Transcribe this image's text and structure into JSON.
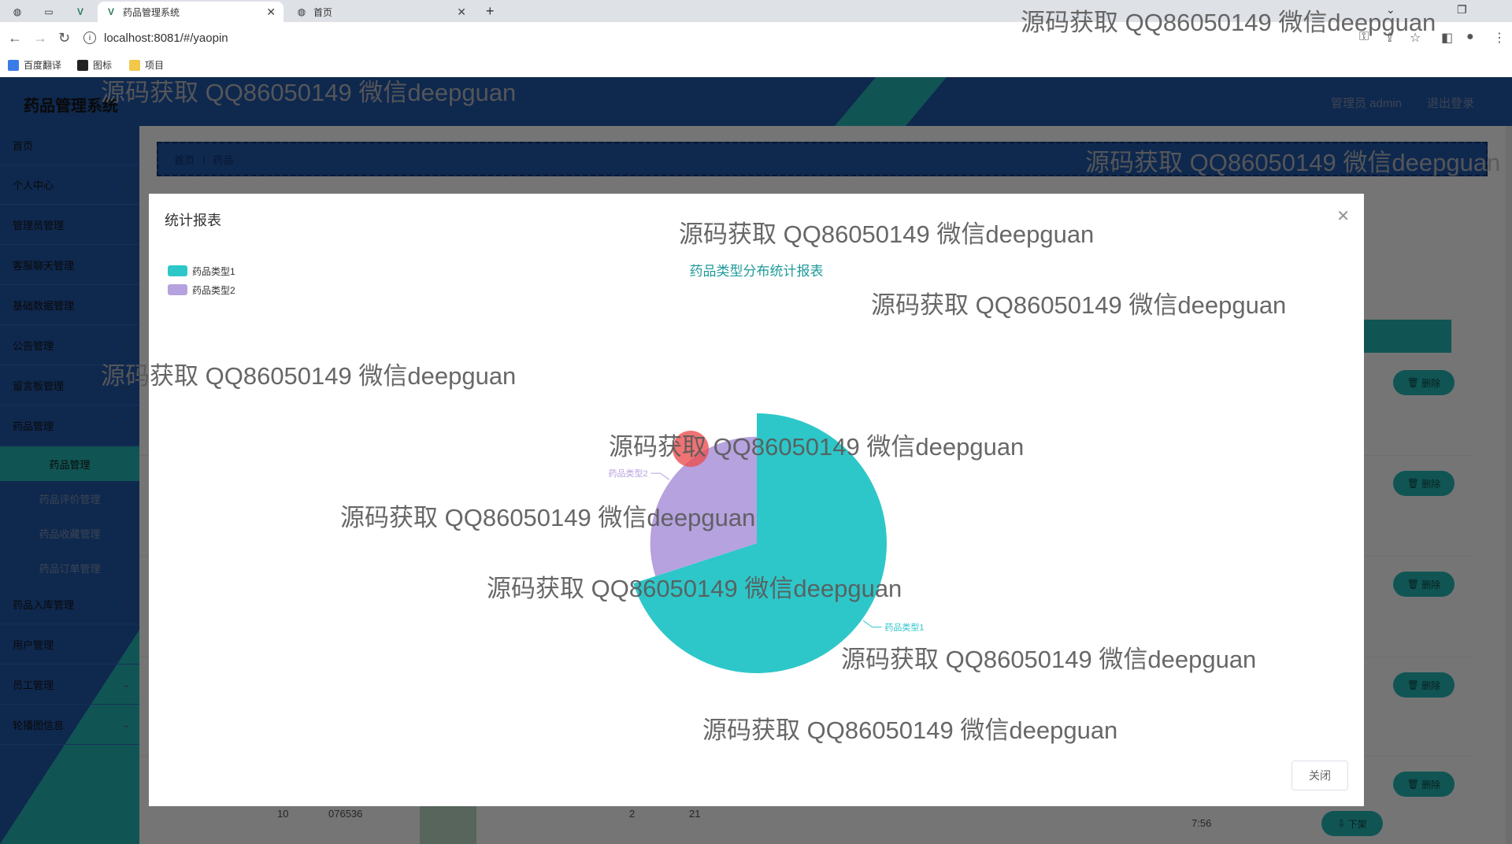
{
  "browser": {
    "tabs": [
      {
        "title": "药品管理系统",
        "active": true
      },
      {
        "title": "首页",
        "active": false
      }
    ],
    "url": "localhost:8081/#/yaopin",
    "bookmarks": [
      "百度翻译",
      "图标",
      "项目"
    ]
  },
  "header": {
    "title": "药品管理系统",
    "user": "管理员 admin",
    "logout": "退出登录"
  },
  "sidebar": {
    "items": [
      {
        "label": "首页",
        "chevron": false
      },
      {
        "label": "个人中心",
        "chevron": true
      },
      {
        "label": "管理员管理",
        "chevron": true
      },
      {
        "label": "客服聊天管理",
        "chevron": true
      },
      {
        "label": "基础数据管理",
        "chevron": true
      },
      {
        "label": "公告管理",
        "chevron": true
      },
      {
        "label": "留言板管理",
        "chevron": true
      },
      {
        "label": "药品管理",
        "chevron": true
      }
    ],
    "sub_items": [
      "药品管理",
      "药品评价管理",
      "药品收藏管理",
      "药品订单管理"
    ],
    "items_after": [
      {
        "label": "药品入库管理"
      },
      {
        "label": "用户管理"
      },
      {
        "label": "员工管理"
      },
      {
        "label": "轮播图信息"
      }
    ]
  },
  "breadcrumb": {
    "home": "首页",
    "current": "药品"
  },
  "table": {
    "delete_label": "删除",
    "off_shelf_label": "下架",
    "bottom_row": [
      "10",
      "076536",
      "2",
      "21",
      "7:56"
    ]
  },
  "dialog": {
    "title": "统计报表",
    "close_button": "关闭"
  },
  "chart_data": {
    "type": "pie",
    "title": "药品类型分布统计报表",
    "legend_position": "top-left",
    "slices": [
      {
        "name": "药品类型1",
        "value": 70,
        "color": "#2ec7c9"
      },
      {
        "name": "药品类型2",
        "value": 30,
        "color": "#b6a2de"
      }
    ]
  },
  "watermark": "源码获取 QQ86050149 微信deepguan"
}
